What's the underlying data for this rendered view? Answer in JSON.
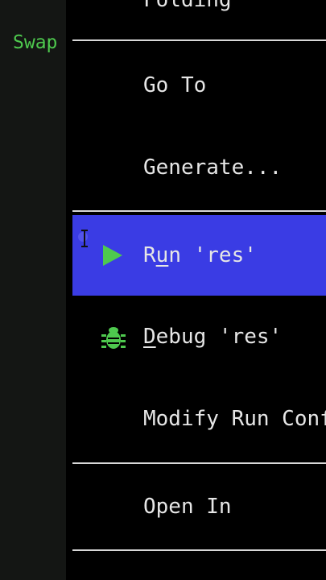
{
  "editor": {
    "swap_text": "Swap"
  },
  "menu": {
    "partial_top_label": "Folding",
    "items": [
      {
        "id": "go-to",
        "label": "Go To"
      },
      {
        "id": "generate",
        "label": "Generate..."
      },
      {
        "id": "run",
        "label_before": "R",
        "label_mnemonic": "u",
        "label_after": "n 'res'",
        "icon": "run-icon",
        "selected": true
      },
      {
        "id": "debug",
        "label_mnemonic": "D",
        "label_after": "ebug 'res'",
        "icon": "bug-icon"
      },
      {
        "id": "modify-run",
        "label": "Modify Run Configuration..."
      },
      {
        "id": "open-in",
        "label": "Open In"
      }
    ]
  },
  "colors": {
    "selection": "#3a3ce4",
    "accent_green": "#4ec94e",
    "text": "#e6e6e6",
    "background": "#000000"
  }
}
